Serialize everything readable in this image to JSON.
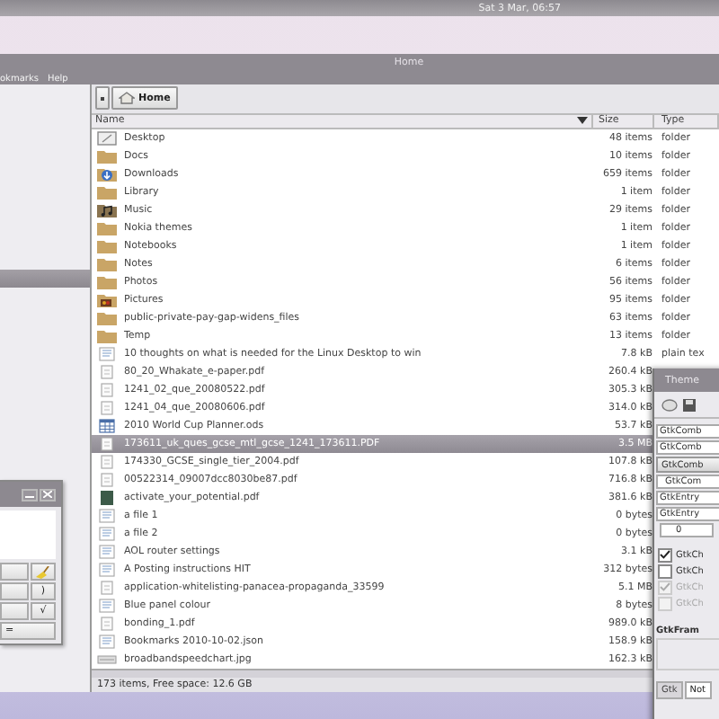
{
  "top_panel": {
    "clock": "Sat  3 Mar, 06:57"
  },
  "file_manager": {
    "title": "Home",
    "menu": [
      "okmarks",
      "Help"
    ],
    "path_button": "Home",
    "columns": [
      {
        "label": "Name",
        "sorted": true
      },
      {
        "label": "Size",
        "sorted": false
      },
      {
        "label": "Type",
        "sorted": false
      }
    ],
    "rows": [
      {
        "kind": "desktop",
        "name": "Desktop",
        "size": "48 items",
        "type": "folder",
        "selected": false
      },
      {
        "kind": "folder",
        "name": "Docs",
        "size": "10 items",
        "type": "folder",
        "selected": false
      },
      {
        "kind": "downloads",
        "name": "Downloads",
        "size": "659 items",
        "type": "folder",
        "selected": false
      },
      {
        "kind": "folder",
        "name": "Library",
        "size": "1 item",
        "type": "folder",
        "selected": false
      },
      {
        "kind": "music",
        "name": "Music",
        "size": "29 items",
        "type": "folder",
        "selected": false
      },
      {
        "kind": "folder",
        "name": "Nokia themes",
        "size": "1 item",
        "type": "folder",
        "selected": false
      },
      {
        "kind": "folder",
        "name": "Notebooks",
        "size": "1 item",
        "type": "folder",
        "selected": false
      },
      {
        "kind": "folder",
        "name": "Notes",
        "size": "6 items",
        "type": "folder",
        "selected": false
      },
      {
        "kind": "folder",
        "name": "Photos",
        "size": "56 items",
        "type": "folder",
        "selected": false
      },
      {
        "kind": "pictures",
        "name": "Pictures",
        "size": "95 items",
        "type": "folder",
        "selected": false
      },
      {
        "kind": "folder",
        "name": "public-private-pay-gap-widens_files",
        "size": "63 items",
        "type": "folder",
        "selected": false
      },
      {
        "kind": "folder",
        "name": "Temp",
        "size": "13 items",
        "type": "folder",
        "selected": false
      },
      {
        "kind": "text",
        "name": "10 thoughts on what is needed for the Linux Desktop to win",
        "size": "7.8 kB",
        "type": "plain tex",
        "selected": false
      },
      {
        "kind": "pdf",
        "name": "80_20_Whakate_e-paper.pdf",
        "size": "260.4 kB",
        "selected": false
      },
      {
        "kind": "pdf",
        "name": "1241_02_que_20080522.pdf",
        "size": "305.3 kB",
        "selected": false
      },
      {
        "kind": "pdf",
        "name": "1241_04_que_20080606.pdf",
        "size": "314.0 kB",
        "selected": false
      },
      {
        "kind": "spreadsheet",
        "name": "2010 World Cup Planner.ods",
        "size": "53.7 kB",
        "selected": false
      },
      {
        "kind": "pdf",
        "name": "173611_uk_ques_gcse_mtl_gcse_1241_173611.PDF",
        "size": "3.5 MB",
        "selected": true
      },
      {
        "kind": "pdf",
        "name": "174330_GCSE_single_tier_2004.pdf",
        "size": "107.8 kB",
        "selected": false
      },
      {
        "kind": "pdf",
        "name": "00522314_09007dcc8030be87.pdf",
        "size": "716.8 kB",
        "selected": false
      },
      {
        "kind": "thumbnail",
        "name": "activate_your_potential.pdf",
        "size": "381.6 kB",
        "selected": false
      },
      {
        "kind": "text",
        "name": "a file 1",
        "size": "0 bytes",
        "selected": false
      },
      {
        "kind": "text",
        "name": "a file 2",
        "size": "0 bytes",
        "selected": false
      },
      {
        "kind": "text",
        "name": "AOL router settings",
        "size": "3.1 kB",
        "selected": false
      },
      {
        "kind": "text",
        "name": "A Posting instructions HIT",
        "size": "312 bytes",
        "selected": false
      },
      {
        "kind": "pdf",
        "name": "application-whitelisting-panacea-propaganda_33599",
        "size": "5.1 MB",
        "selected": false
      },
      {
        "kind": "text",
        "name": "Blue panel colour",
        "size": "8 bytes",
        "selected": false
      },
      {
        "kind": "pdf",
        "name": "bonding_1.pdf",
        "size": "989.0 kB",
        "selected": false
      },
      {
        "kind": "text",
        "name": "Bookmarks 2010-10-02.json",
        "size": "158.9 kB",
        "selected": false
      },
      {
        "kind": "image",
        "name": "broadbandspeedchart.jpg",
        "size": "162.3 kB",
        "selected": false
      }
    ],
    "status": "173 items, Free space: 12.6 GB"
  },
  "calculator": {
    "buttons": [
      {
        "kind": "blank"
      },
      {
        "kind": "clear"
      },
      {
        "kind": "blank"
      },
      {
        "kind": "text",
        "label": ")"
      },
      {
        "kind": "blank"
      },
      {
        "kind": "text",
        "label": "√"
      },
      {
        "kind": "wide",
        "label": "="
      }
    ]
  },
  "theme_window": {
    "title": "Theme",
    "combos": [
      {
        "kind": "combo",
        "label": "GtkComb"
      },
      {
        "kind": "combo",
        "label": "GtkComb"
      },
      {
        "kind": "button",
        "label": "GtkComb"
      },
      {
        "kind": "entry",
        "label": "GtkCom"
      }
    ],
    "entries": [
      "GtkEntry",
      "GtkEntry"
    ],
    "spin": "0",
    "checks": [
      {
        "label": "GtkCh",
        "checked": true,
        "disabled": false
      },
      {
        "label": "GtkCh",
        "checked": false,
        "disabled": false
      },
      {
        "label": "GtkCh",
        "checked": true,
        "disabled": true
      },
      {
        "label": "GtkCh",
        "checked": false,
        "disabled": true
      }
    ],
    "frame": "GtkFram",
    "tabs": [
      {
        "label": "Gtk",
        "selected": false
      },
      {
        "label": "Not",
        "selected": true
      }
    ]
  }
}
